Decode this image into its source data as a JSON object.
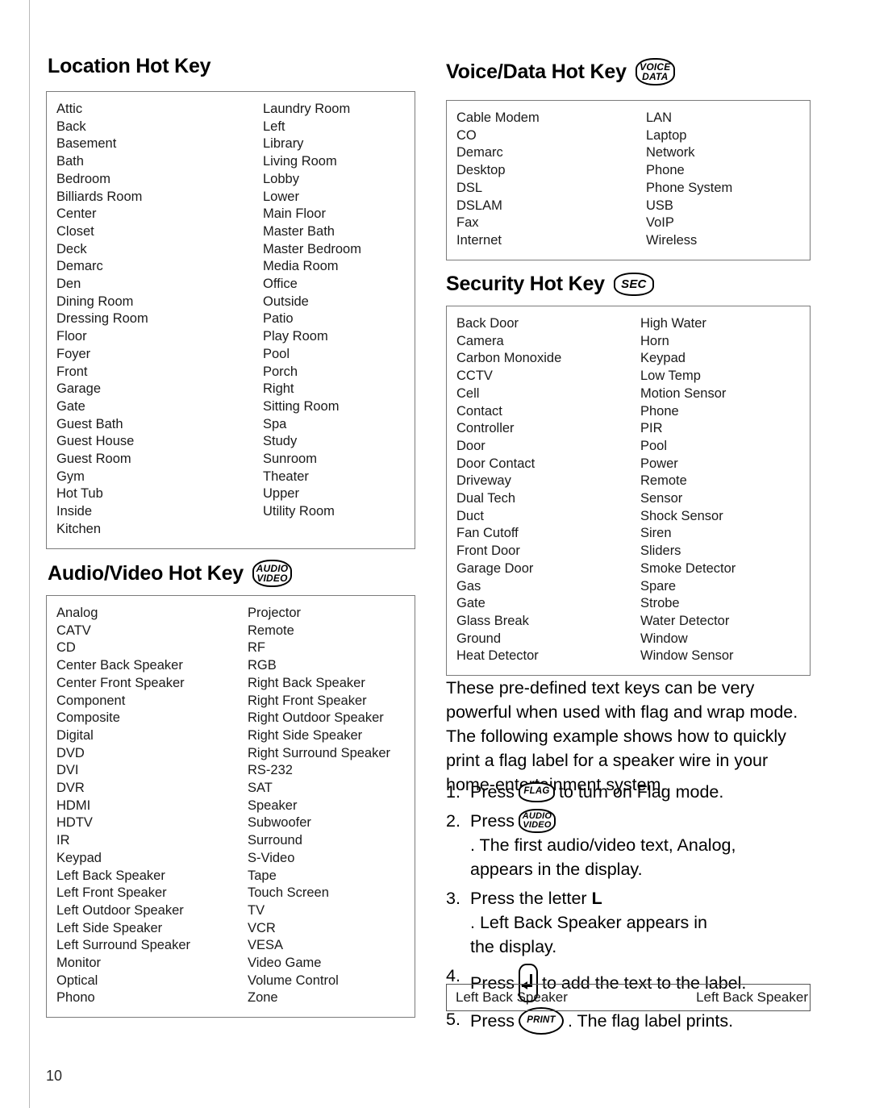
{
  "page": {
    "number": "10"
  },
  "sections": {
    "location": {
      "title": "Location Hot Key",
      "column_1": [
        "Attic",
        "Back",
        "Basement",
        "Bath",
        "Bedroom",
        "Billiards Room",
        "Center",
        "Closet",
        "Deck",
        "Demarc",
        "Den",
        "Dining Room",
        "Dressing Room",
        "Floor",
        "Foyer",
        "Front",
        "Garage",
        "Gate",
        "Guest Bath",
        "Guest House",
        "Guest Room",
        "Gym",
        "Hot Tub",
        "Inside",
        "Kitchen"
      ],
      "column_2": [
        "Laundry Room",
        "Left",
        "Library",
        "Living Room",
        "Lobby",
        "Lower",
        "Main Floor",
        "Master Bath",
        "Master Bedroom",
        "Media Room",
        "Office",
        "Outside",
        "Patio",
        "Play Room",
        "Pool",
        "Porch",
        "Right",
        "Sitting Room",
        "Spa",
        "Study",
        "Sunroom",
        "Theater",
        "Upper",
        "Utility Room"
      ]
    },
    "audio_video": {
      "title": "Audio/Video Hot Key",
      "key_line_1": "AUDIO",
      "key_line_2": "VIDEO",
      "column_1": [
        "Analog",
        "CATV",
        "CD",
        "Center Back Speaker",
        "Center Front Speaker",
        "Component",
        "Composite",
        "Digital",
        "DVD",
        "DVI",
        "DVR",
        "HDMI",
        "HDTV",
        "IR",
        "Keypad",
        "Left Back Speaker",
        "Left Front Speaker",
        "Left Outdoor Speaker",
        "Left Side Speaker",
        "Left Surround Speaker",
        "Monitor",
        "Optical",
        "Phono"
      ],
      "column_2": [
        "Projector",
        "Remote",
        "RF",
        "RGB",
        "Right Back Speaker",
        "Right Front Speaker",
        "Right Outdoor Speaker",
        "Right Side Speaker",
        "Right Surround Speaker",
        "RS-232",
        "SAT",
        "Speaker",
        "Subwoofer",
        "Surround",
        "S-Video",
        "Tape",
        "Touch Screen",
        "TV",
        "VCR",
        "VESA",
        "Video Game",
        "Volume Control",
        "Zone"
      ]
    },
    "voice_data": {
      "title": "Voice/Data Hot Key",
      "key_line_1": "VOICE",
      "key_line_2": "DATA",
      "column_1": [
        "Cable Modem",
        "CO",
        "Demarc",
        "Desktop",
        "DSL",
        "DSLAM",
        "Fax",
        "Internet"
      ],
      "column_2": [
        "LAN",
        "Laptop",
        "Network",
        "Phone",
        "Phone System",
        "USB",
        "VoIP",
        "Wireless"
      ]
    },
    "security": {
      "title": "Security Hot Key",
      "key_label": "SEC",
      "column_1": [
        "Back Door",
        "Camera",
        "Carbon Monoxide",
        "CCTV",
        "Cell",
        "Contact",
        "Controller",
        "Door",
        "Door Contact",
        "Driveway",
        "Dual Tech",
        "Duct",
        "Fan Cutoff",
        "Front Door",
        "Garage Door",
        "Gas",
        "Gate",
        "Glass Break",
        "Ground",
        "Heat Detector"
      ],
      "column_2": [
        "High Water",
        "Horn",
        "Keypad",
        "Low Temp",
        "Motion Sensor",
        "Phone",
        "PIR",
        "Pool",
        "Power",
        "Remote",
        "Sensor",
        "Shock Sensor",
        "Siren",
        "Sliders",
        "Smoke Detector",
        "Spare",
        "Strobe",
        "Water Detector",
        "Window",
        "Window Sensor"
      ]
    }
  },
  "example": {
    "intro": "These pre-defined text keys can be very powerful when used with flag and wrap mode. The following example shows how to quickly print a flag label for a speaker wire in your home-entertainment system.",
    "steps": [
      {
        "number": "1.",
        "before": "Press",
        "key": "FLAG",
        "after": "to turn on Flag mode.",
        "second_line": ""
      },
      {
        "number": "2.",
        "before": "Press",
        "key_line_1": "AUDIO",
        "key_line_2": "VIDEO",
        "after": ". The first audio/video text, Analog,",
        "second_line": "appears in the display."
      },
      {
        "number": "3.",
        "before": "Press the letter",
        "bold": "L",
        "after": ". Left Back Speaker appears in",
        "second_line": "the display."
      },
      {
        "number": "4.",
        "before": "Press",
        "key": "enter-key",
        "after": "to add the text to the label.",
        "second_line": ""
      },
      {
        "number": "5.",
        "before": "Press",
        "key": "PRINT",
        "after": ". The flag label prints.",
        "second_line": ""
      }
    ],
    "label_preview": {
      "left_text": "Left Back Speaker",
      "right_text": "Left Back Speaker"
    }
  }
}
